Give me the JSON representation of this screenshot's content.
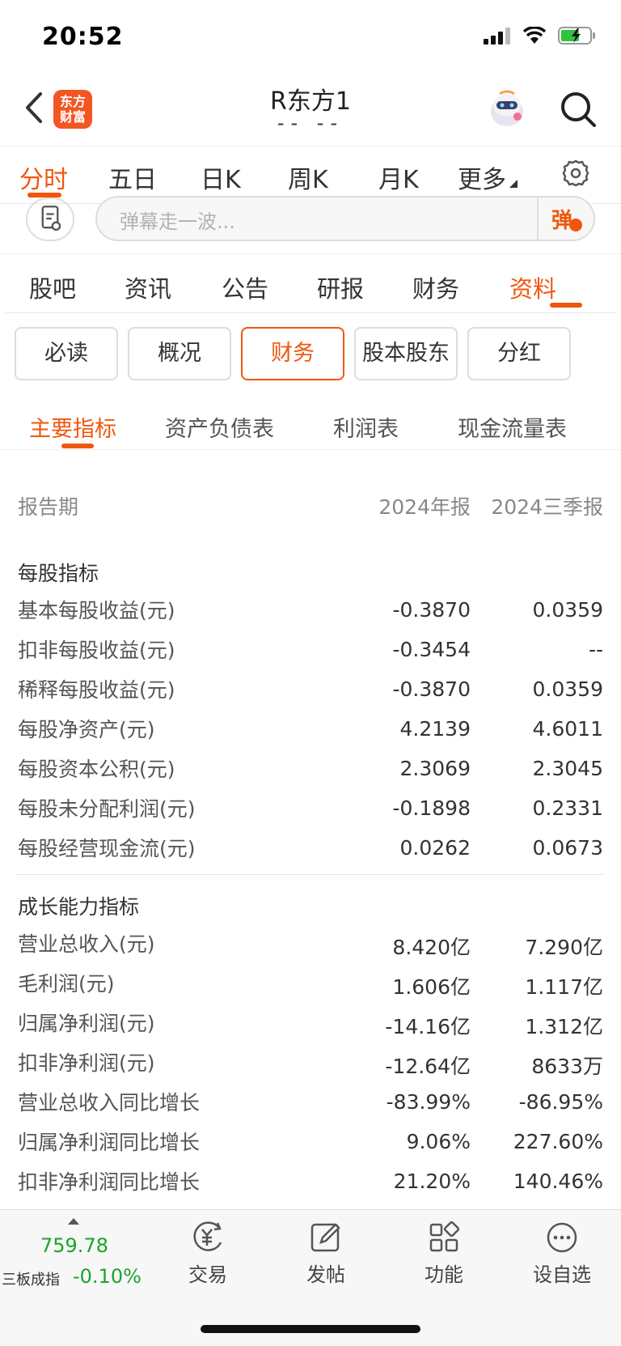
{
  "status_bar": {
    "time": "20:52"
  },
  "header": {
    "title": "R东方1",
    "subtitle": "-- --",
    "logo_text": "东方财富"
  },
  "chart_tabs": [
    {
      "label": "分时",
      "active": true
    },
    {
      "label": "五日"
    },
    {
      "label": "日K"
    },
    {
      "label": "周K"
    },
    {
      "label": "月K"
    },
    {
      "label": "更多"
    }
  ],
  "danmu": {
    "placeholder": "弹幕走一波...",
    "button": "弹"
  },
  "main_tabs": [
    {
      "label": "股吧"
    },
    {
      "label": "资讯"
    },
    {
      "label": "公告"
    },
    {
      "label": "研报"
    },
    {
      "label": "财务"
    },
    {
      "label": "资料",
      "active": true
    }
  ],
  "segments": [
    {
      "label": "必读"
    },
    {
      "label": "概况"
    },
    {
      "label": "财务",
      "active": true
    },
    {
      "label": "股本股东"
    },
    {
      "label": "分红"
    }
  ],
  "sub_tabs": [
    {
      "label": "主要指标",
      "active": true
    },
    {
      "label": "资产负债表"
    },
    {
      "label": "利润表"
    },
    {
      "label": "现金流量表"
    }
  ],
  "table": {
    "header": {
      "label": "报告期",
      "col1": "2024年报",
      "col2": "2024三季报"
    },
    "sections": [
      {
        "title": "每股指标",
        "rows": [
          {
            "label": "基本每股收益(元)",
            "v1": "-0.3870",
            "v2": "0.0359"
          },
          {
            "label": "扣非每股收益(元)",
            "v1": "-0.3454",
            "v2": "--"
          },
          {
            "label": "稀释每股收益(元)",
            "v1": "-0.3870",
            "v2": "0.0359"
          },
          {
            "label": "每股净资产(元)",
            "v1": "4.2139",
            "v2": "4.6011"
          },
          {
            "label": "每股资本公积(元)",
            "v1": "2.3069",
            "v2": "2.3045"
          },
          {
            "label": "每股未分配利润(元)",
            "v1": "-0.1898",
            "v2": "0.2331"
          },
          {
            "label": "每股经营现金流(元)",
            "v1": "0.0262",
            "v2": "0.0673"
          }
        ]
      },
      {
        "title": "成长能力指标",
        "rows": [
          {
            "label": "营业总收入(元)",
            "v1": "8.420亿",
            "v2": "7.290亿"
          },
          {
            "label": "毛利润(元)",
            "v1": "1.606亿",
            "v2": "1.117亿"
          },
          {
            "label": "归属净利润(元)",
            "v1": "-14.16亿",
            "v2": "1.312亿"
          },
          {
            "label": "扣非净利润(元)",
            "v1": "-12.64亿",
            "v2": "8633万"
          },
          {
            "label": "营业总收入同比增长",
            "v1": "-83.99%",
            "v2": "-86.95%"
          },
          {
            "label": "归属净利润同比增长",
            "v1": "9.06%",
            "v2": "227.60%"
          },
          {
            "label": "扣非净利润同比增长",
            "v1": "21.20%",
            "v2": "140.46%"
          }
        ]
      }
    ]
  },
  "bottom_bar": {
    "index_value": "759.78",
    "index_name": "三板成指",
    "index_change": "-0.10%",
    "index_color": "#1aa52a",
    "buttons": [
      {
        "label": "交易",
        "icon": "trade-icon"
      },
      {
        "label": "发帖",
        "icon": "compose-icon"
      },
      {
        "label": "功能",
        "icon": "grid-icon"
      },
      {
        "label": "设自选",
        "icon": "more-icon"
      }
    ]
  },
  "colors": {
    "accent": "#f0570d",
    "text": "#333333",
    "muted": "#888888"
  }
}
